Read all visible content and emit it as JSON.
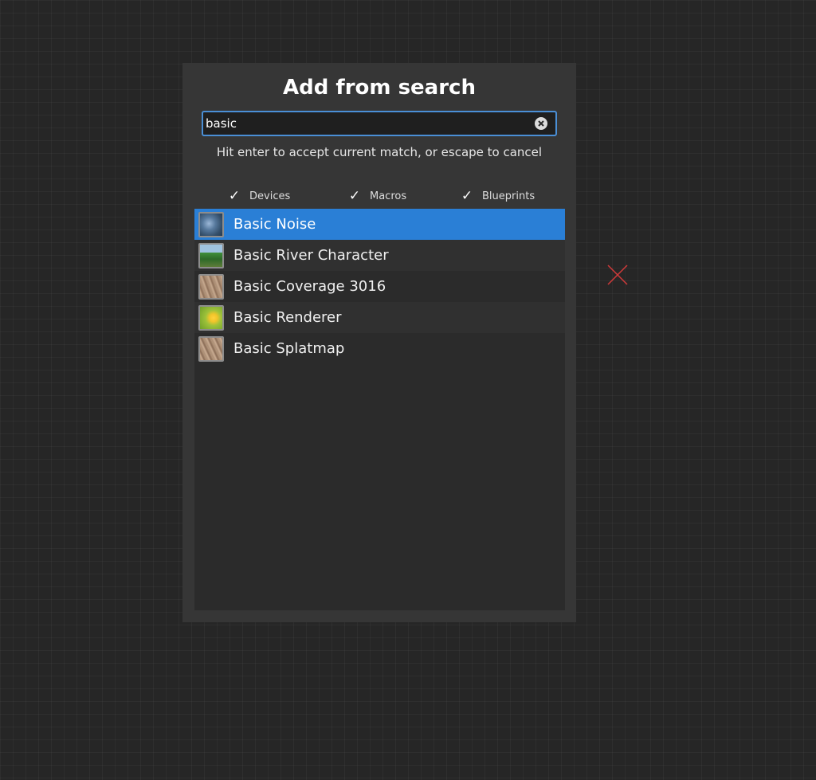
{
  "dialog": {
    "title": "Add from search",
    "search": {
      "value": "basic",
      "clear_icon": "close-circle-icon"
    },
    "hint": "Hit enter to accept current match, or escape to cancel",
    "filters": [
      {
        "label": "Devices",
        "checked": true
      },
      {
        "label": "Macros",
        "checked": true
      },
      {
        "label": "Blueprints",
        "checked": true
      }
    ],
    "results": [
      {
        "label": "Basic Noise",
        "icon": "noise-thumbnail-icon",
        "selected": true
      },
      {
        "label": "Basic River Character",
        "icon": "river-thumbnail-icon",
        "selected": false
      },
      {
        "label": "Basic Coverage 3016",
        "icon": "coverage-thumbnail-icon",
        "selected": false
      },
      {
        "label": "Basic Renderer",
        "icon": "renderer-thumbnail-icon",
        "selected": false
      },
      {
        "label": "Basic Splatmap",
        "icon": "splatmap-thumbnail-icon",
        "selected": false
      }
    ]
  },
  "canvas": {
    "marker_icon": "red-x-marker-icon",
    "marker_color": "#d03a3a"
  },
  "colors": {
    "accent": "#2a7fd6",
    "search_border": "#4a8fd6",
    "dialog_bg": "#363636",
    "list_bg": "#2b2b2b"
  }
}
